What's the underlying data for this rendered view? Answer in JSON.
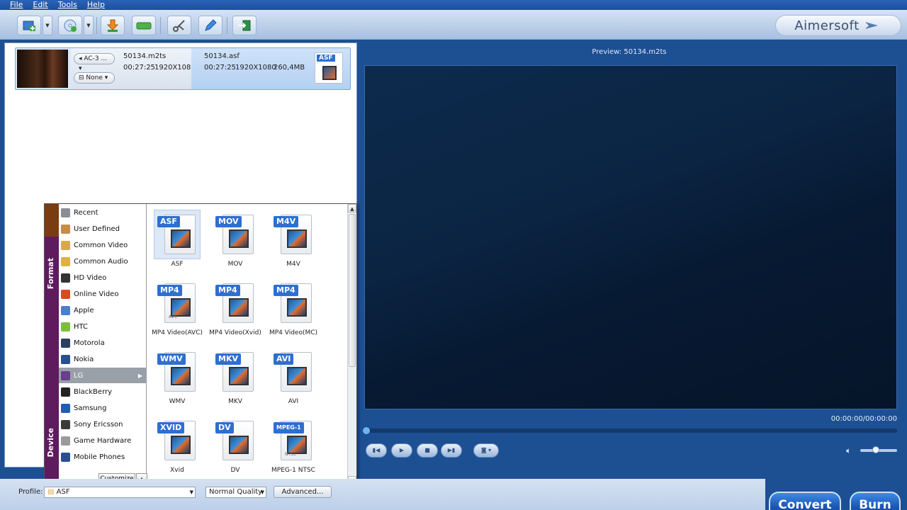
{
  "menu": [
    "File",
    "Edit",
    "Tools",
    "Help"
  ],
  "brand": "Aimersoft",
  "file": {
    "audio_track": "AC-3 ...",
    "subtitle": "None",
    "src_name": "50134.m2ts",
    "src_duration": "00:27:25",
    "src_res": "1920X1080",
    "dst_name": "50134.asf",
    "dst_duration": "00:27:25",
    "dst_res": "1920X1080",
    "dst_size": "260,4MB",
    "dst_badge": "ASF"
  },
  "dropdown": {
    "format_label": "Format",
    "device_label": "Device",
    "categories": [
      {
        "label": "Recent",
        "color": "#8a8f96"
      },
      {
        "label": "User Defined",
        "color": "#c98b4a"
      },
      {
        "label": "Common Video",
        "color": "#d8a84b"
      },
      {
        "label": "Common Audio",
        "color": "#e0b040"
      },
      {
        "label": "HD Video",
        "color": "#333333"
      },
      {
        "label": "Online Video",
        "color": "#d84a1c"
      },
      {
        "label": "Apple",
        "color": "#4a7ed0"
      },
      {
        "label": "HTC",
        "color": "#7bbf3a"
      },
      {
        "label": "Motorola",
        "color": "#2f3f5f"
      },
      {
        "label": "Nokia",
        "color": "#2a4f8f"
      },
      {
        "label": "LG",
        "color": "#6a3f8f"
      },
      {
        "label": "BlackBerry",
        "color": "#222222"
      },
      {
        "label": "Samsung",
        "color": "#1f5fb0"
      },
      {
        "label": "Sony Ericsson",
        "color": "#3a3a3a"
      },
      {
        "label": "Game Hardware",
        "color": "#9a9a9a"
      },
      {
        "label": "Mobile Phones",
        "color": "#2a4f8f"
      }
    ],
    "customize": "Customize",
    "formats": [
      {
        "badge": "ASF",
        "label": "ASF"
      },
      {
        "badge": "MOV",
        "label": "MOV"
      },
      {
        "badge": "M4V",
        "label": "M4V"
      },
      {
        "badge": "MP4",
        "label": "MP4 Video(AVC)"
      },
      {
        "badge": "MP4",
        "label": "MP4 Video(Xvid)"
      },
      {
        "badge": "MP4",
        "label": "MP4 Video(MC)"
      },
      {
        "badge": "WMV",
        "label": "WMV"
      },
      {
        "badge": "MKV",
        "label": "MKV"
      },
      {
        "badge": "AVI",
        "label": "AVI"
      },
      {
        "badge": "XVID",
        "label": "Xvid"
      },
      {
        "badge": "DV",
        "label": "DV"
      },
      {
        "badge": "MPEG-1",
        "label": "MPEG-1 NTSC"
      }
    ],
    "avc_sub": "AVC",
    "ntsc_sub": "NTSC"
  },
  "bottom": {
    "profile_label": "Profile:",
    "profile_value": "ASF",
    "quality_value": "Normal Quality",
    "advanced": "Advanced..."
  },
  "preview": {
    "title": "Preview: 50134.m2ts",
    "time": "00:00:00/00:00:00",
    "progress": 0
  },
  "actions": {
    "convert": "Convert",
    "burn": "Burn"
  }
}
